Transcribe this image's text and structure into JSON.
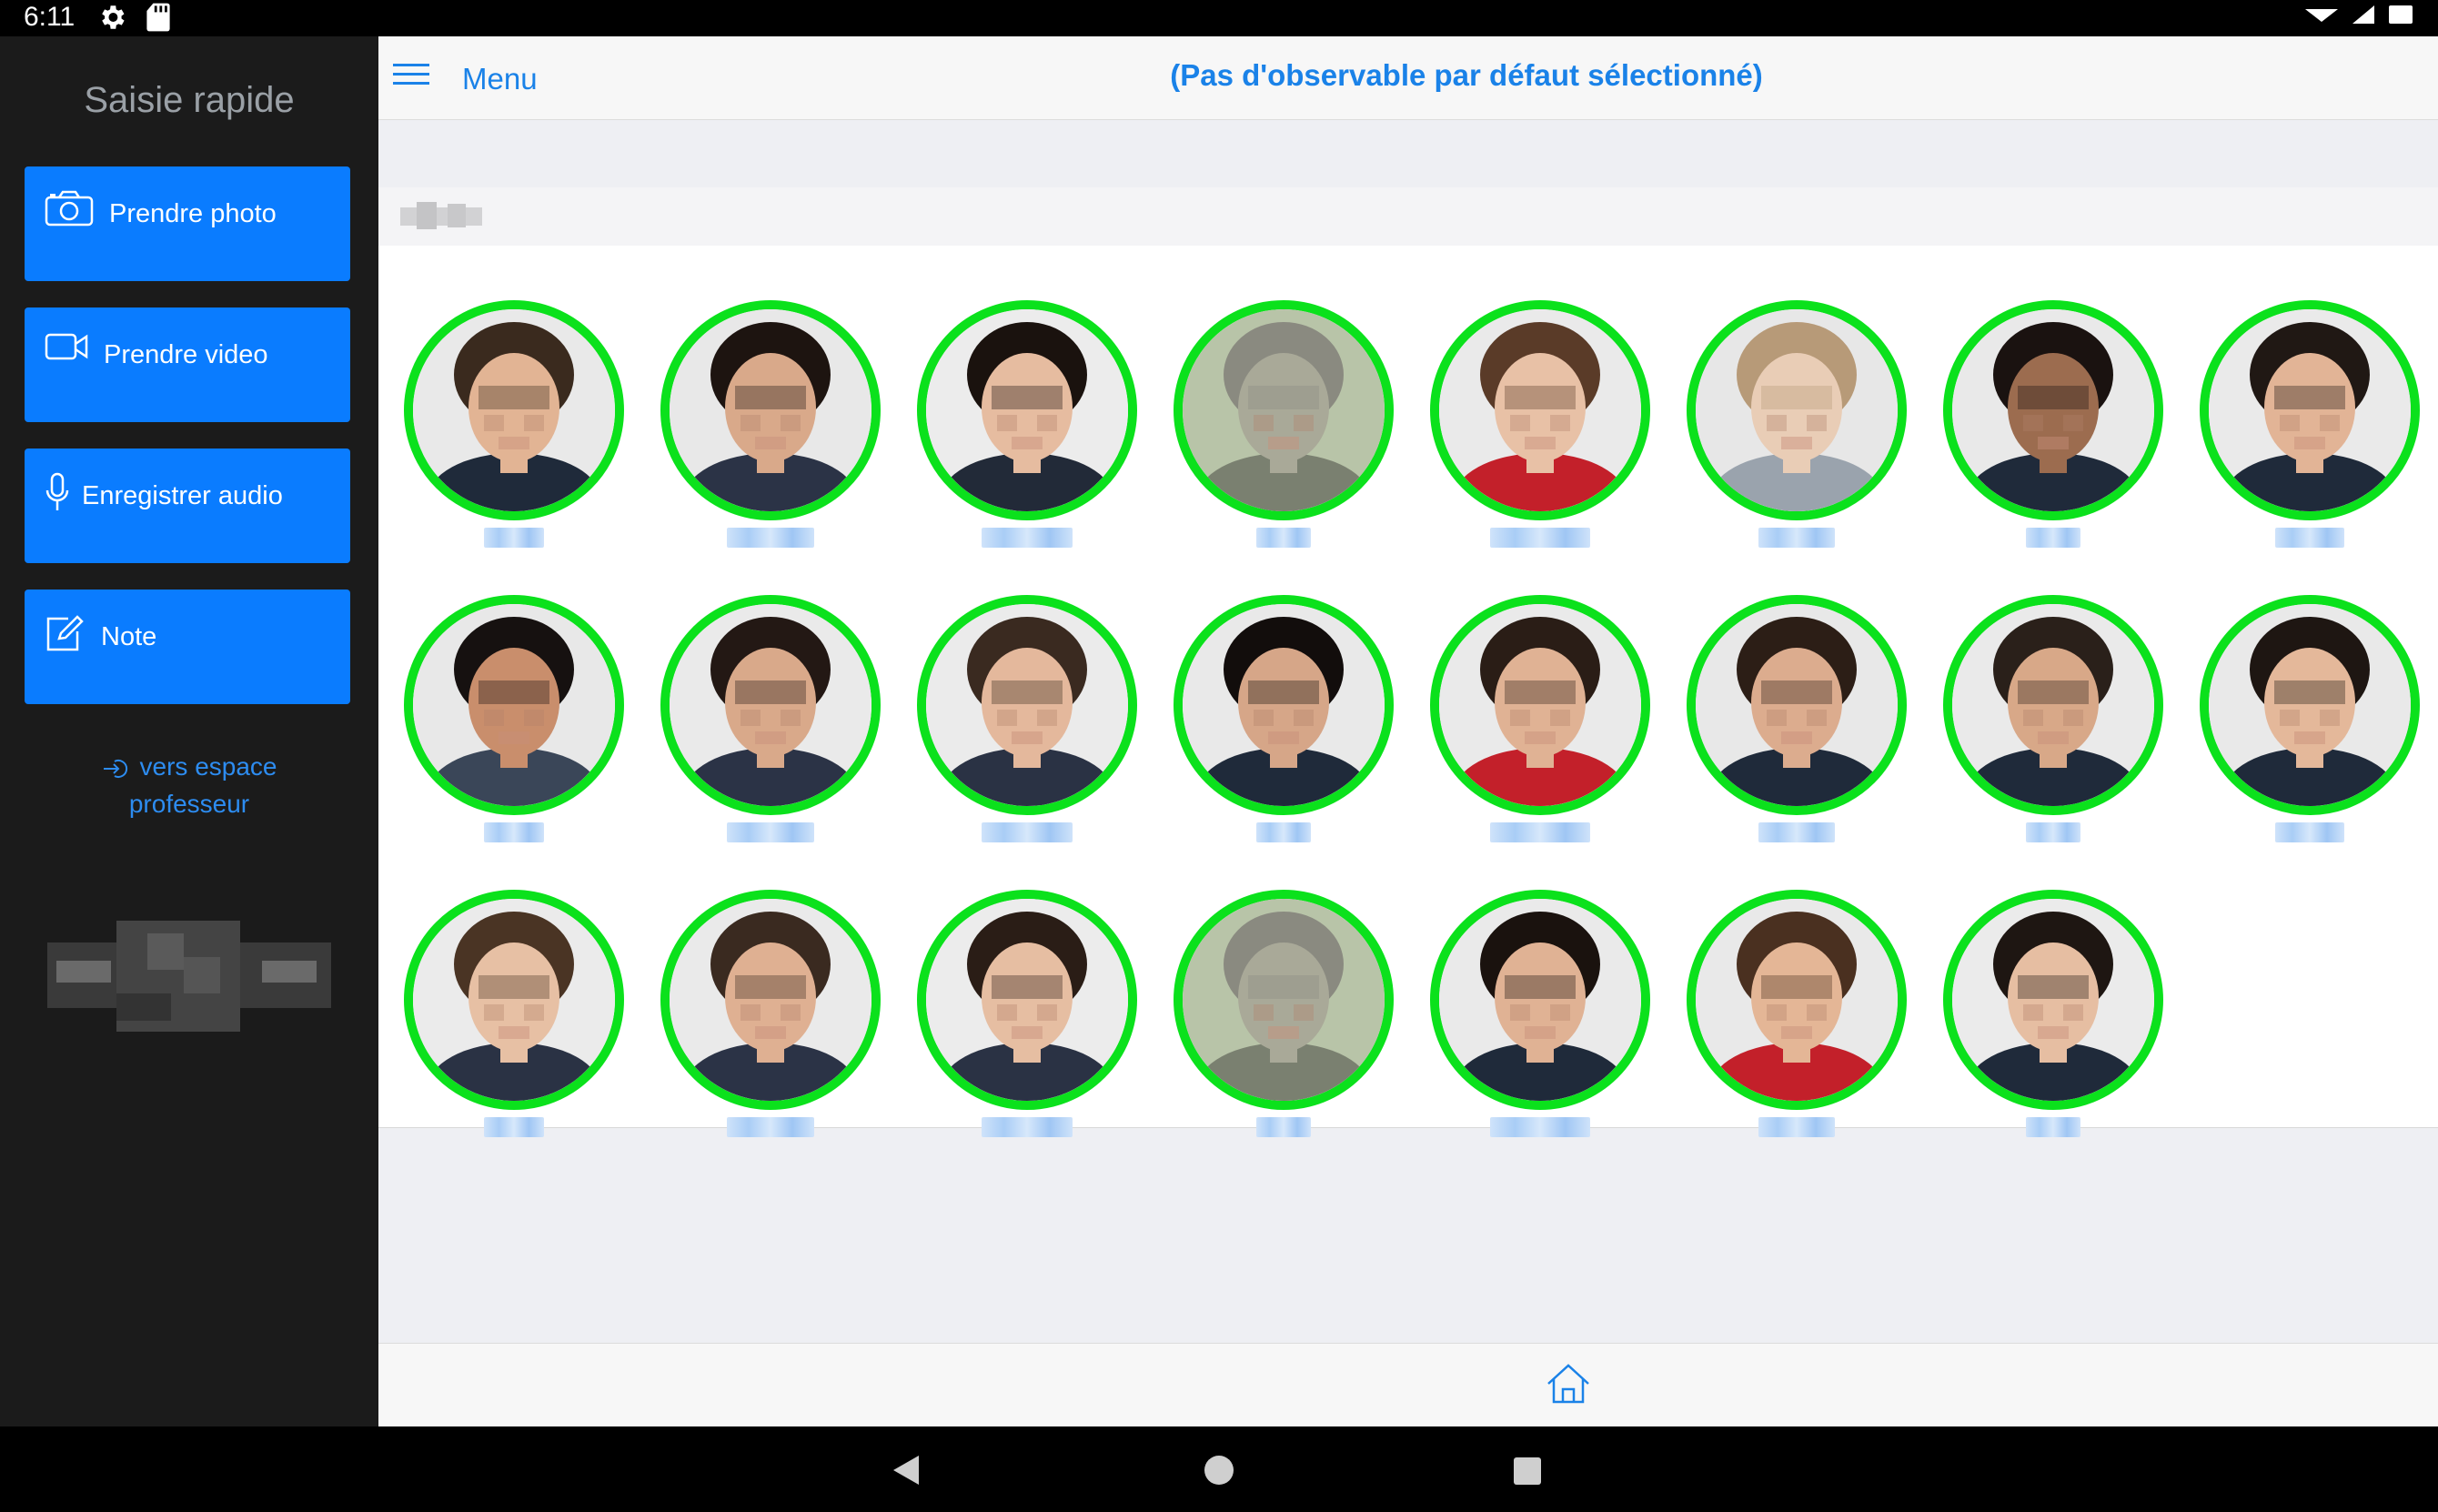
{
  "status_bar": {
    "time": "6:11"
  },
  "sidebar": {
    "title": "Saisie rapide",
    "buttons": [
      {
        "label": "Prendre photo",
        "icon": "camera-icon"
      },
      {
        "label": "Prendre video",
        "icon": "video-camera-icon"
      },
      {
        "label": "Enregistrer audio",
        "icon": "microphone-icon"
      },
      {
        "label": "Note",
        "icon": "edit-note-icon"
      }
    ],
    "teacher_link": {
      "line1": "vers espace",
      "line2": "professeur"
    }
  },
  "topbar": {
    "menu_label": "Menu",
    "observable_text": "(Pas d'observable par défaut sélectionné)"
  },
  "colors": {
    "accent": "#0a7cff",
    "link": "#1a82e8",
    "ring": "#0be11c",
    "sidebar_bg": "#1b1b1b"
  },
  "students": [
    {
      "hair": "#3a2a1e",
      "skin": "#e2b494",
      "shirt": "#1f2a3a",
      "bg": "#e9e9e9"
    },
    {
      "hair": "#1d1410",
      "skin": "#d9a98a",
      "shirt": "#2b3346",
      "bg": "#e8e8e8"
    },
    {
      "hair": "#1a120e",
      "skin": "#e6bca0",
      "shirt": "#222a38",
      "bg": "#ececec"
    },
    {
      "hair": "#8a8a80",
      "skin": "#a9a998",
      "shirt": "#7a8070",
      "bg": "#b8c4a8"
    },
    {
      "hair": "#5a3b28",
      "skin": "#e8c1a6",
      "shirt": "#c3202a",
      "bg": "#eaeaea"
    },
    {
      "hair": "#b79a78",
      "skin": "#e9cdb6",
      "shirt": "#9aa3ad",
      "bg": "#e7e7e7"
    },
    {
      "hair": "#1a1210",
      "skin": "#9c6c4f",
      "shirt": "#1f2a3a",
      "bg": "#e9e9e9"
    },
    {
      "hair": "#201814",
      "skin": "#e2b496",
      "shirt": "#1f2a3a",
      "bg": "#eaeaea"
    },
    {
      "hair": "#161110",
      "skin": "#c98e6c",
      "shirt": "#3a4658",
      "bg": "#e8e8e8"
    },
    {
      "hair": "#231814",
      "skin": "#d9a98a",
      "shirt": "#2b3346",
      "bg": "#eaeaea"
    },
    {
      "hair": "#3a2a20",
      "skin": "#e4b89c",
      "shirt": "#2a3244",
      "bg": "#ebebeb"
    },
    {
      "hair": "#120d0c",
      "skin": "#d6a688",
      "shirt": "#1f2a3a",
      "bg": "#e9e9e9"
    },
    {
      "hair": "#2a1d16",
      "skin": "#e0b294",
      "shirt": "#c3202a",
      "bg": "#eaeaea"
    },
    {
      "hair": "#2c1e16",
      "skin": "#dcac8e",
      "shirt": "#1f2a3a",
      "bg": "#e8e8e8"
    },
    {
      "hair": "#2a201a",
      "skin": "#d8a888",
      "shirt": "#1f2a3a",
      "bg": "#eaeaea"
    },
    {
      "hair": "#1e1612",
      "skin": "#e4b89a",
      "shirt": "#1f2a3a",
      "bg": "#e9e9e9"
    },
    {
      "hair": "#4a3424",
      "skin": "#e7c0a4",
      "shirt": "#2a3244",
      "bg": "#ebebeb"
    },
    {
      "hair": "#3a2a20",
      "skin": "#dfb092",
      "shirt": "#2b3346",
      "bg": "#eaeaea"
    },
    {
      "hair": "#2a1d16",
      "skin": "#e6bea2",
      "shirt": "#2a3244",
      "bg": "#ececec"
    },
    {
      "hair": "#8a8a80",
      "skin": "#a9a998",
      "shirt": "#7a8070",
      "bg": "#b8c4a8"
    },
    {
      "hair": "#1a120e",
      "skin": "#e0b294",
      "shirt": "#1f2a3a",
      "bg": "#eaeaea"
    },
    {
      "hair": "#4a3020",
      "skin": "#e4b696",
      "shirt": "#c3202a",
      "bg": "#e9e9e9"
    },
    {
      "hair": "#1e1612",
      "skin": "#e6bea2",
      "shirt": "#1f2a3a",
      "bg": "#ebebeb"
    }
  ]
}
